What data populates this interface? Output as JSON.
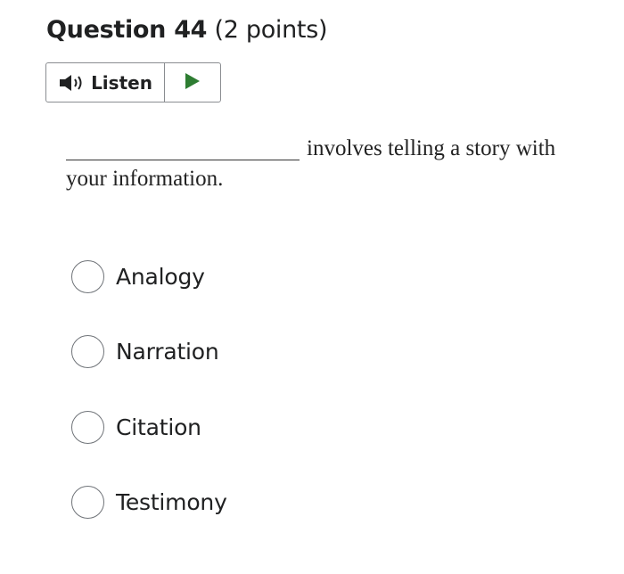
{
  "question": {
    "number_label": "Question 44",
    "points_label": "(2 points)",
    "stem_text": "involves telling a story with your information."
  },
  "listen": {
    "label": "Listen",
    "speaker_icon": "speaker-icon",
    "play_icon": "play-icon",
    "play_color": "#2e7d32"
  },
  "options": [
    {
      "label": "Analogy",
      "selected": false
    },
    {
      "label": "Narration",
      "selected": false
    },
    {
      "label": "Citation",
      "selected": false
    },
    {
      "label": "Testimony",
      "selected": false
    }
  ]
}
